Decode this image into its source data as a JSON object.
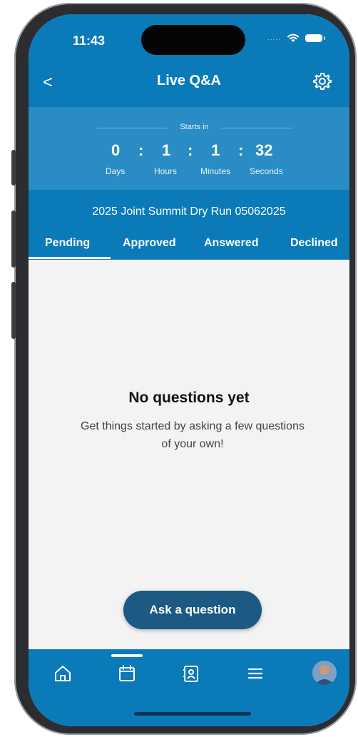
{
  "status_bar": {
    "time": "11:43",
    "signal": "....."
  },
  "header": {
    "back_glyph": "<",
    "title": "Live Q&A"
  },
  "countdown": {
    "label": "Starts in",
    "days": "0",
    "hours": "1",
    "minutes": "1",
    "seconds": "32",
    "separator": ":",
    "days_label": "Days",
    "hours_label": "Hours",
    "minutes_label": "Minutes",
    "seconds_label": "Seconds"
  },
  "session": {
    "title": "2025 Joint Summit Dry Run 05062025"
  },
  "tabs": [
    {
      "label": "Pending",
      "active": true
    },
    {
      "label": "Approved",
      "active": false
    },
    {
      "label": "Answered",
      "active": false
    },
    {
      "label": "Declined",
      "active": false
    }
  ],
  "empty_state": {
    "title": "No questions yet",
    "message": "Get things started by asking a few questions of your own!"
  },
  "ask_button": {
    "label": "Ask a question"
  },
  "bottom_nav": {
    "items": [
      "home-icon",
      "calendar-icon",
      "contacts-icon",
      "menu-icon",
      "profile-avatar"
    ],
    "active": "calendar-icon"
  },
  "colors": {
    "brand": "#0a7ab9",
    "countdown_bg": "#2a8cc4",
    "button": "#1c5a83",
    "content_bg": "#f3f3f3"
  }
}
